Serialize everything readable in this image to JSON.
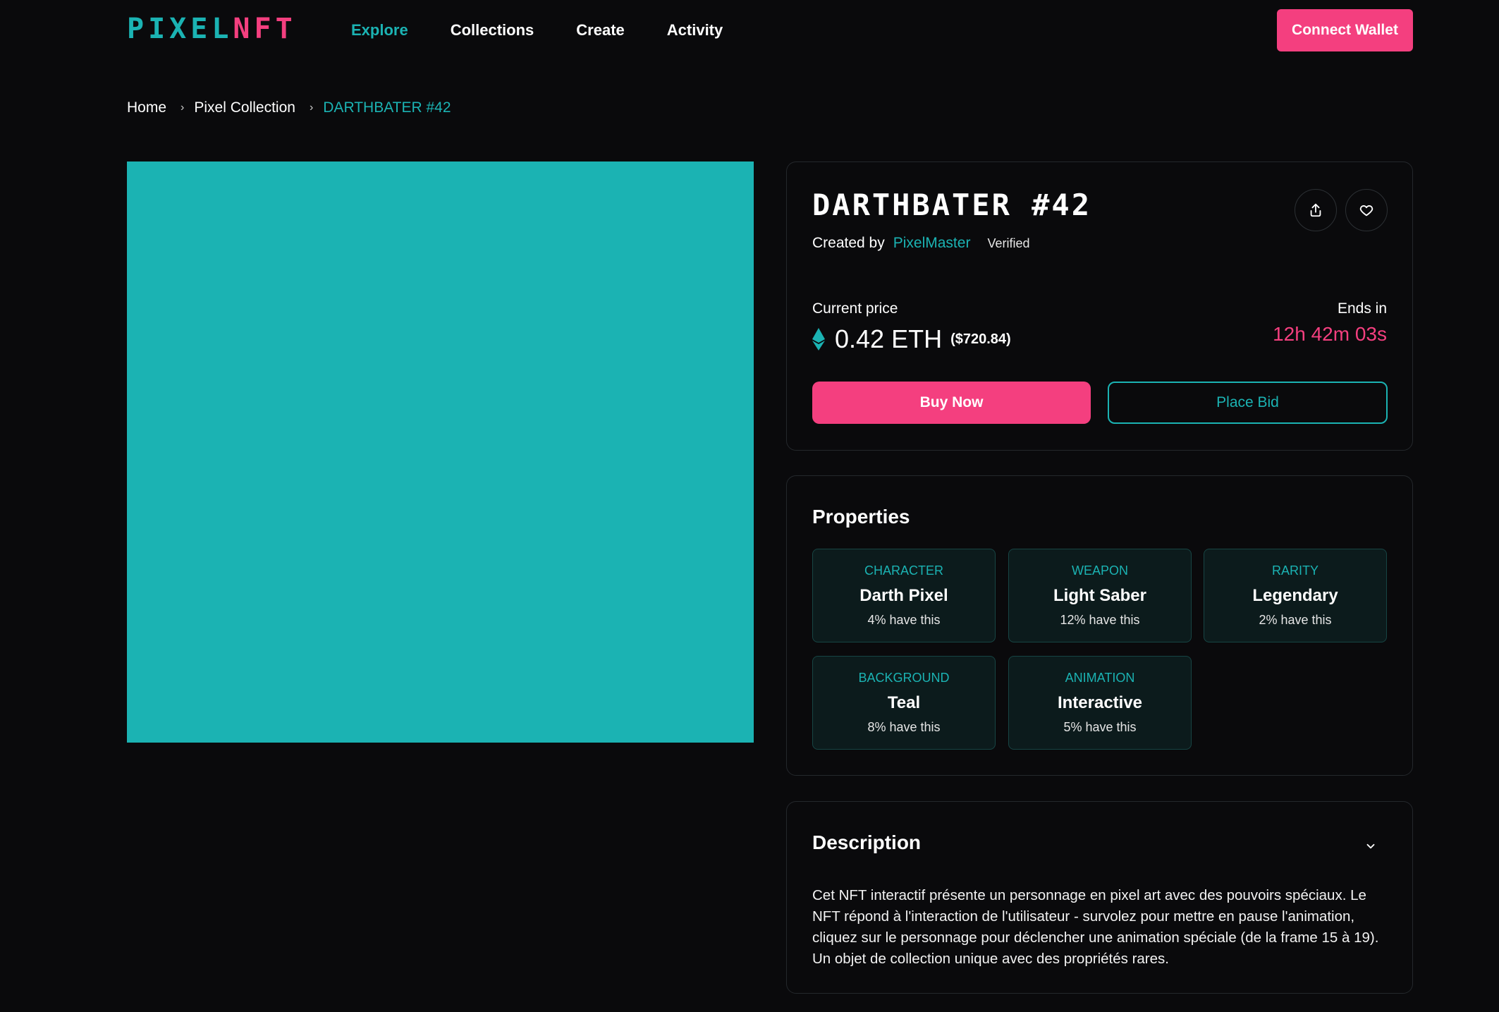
{
  "brand": {
    "part1": "PIXEL",
    "part2": "NFT",
    "accent": "#1bb3b3",
    "pink": "#f43f7f"
  },
  "nav": {
    "items": [
      {
        "label": "Explore",
        "active": true
      },
      {
        "label": "Collections"
      },
      {
        "label": "Create"
      },
      {
        "label": "Activity"
      }
    ],
    "connect_label": "Connect Wallet"
  },
  "breadcrumb": {
    "home": "Home",
    "collection": "Pixel Collection",
    "current": "DARTHBATER #42"
  },
  "nft": {
    "title": "DARTHBATER #42",
    "created_by_label": "Created by",
    "creator": "PixelMaster",
    "verified": "Verified",
    "artwork_color": "#1bb3b3",
    "icons": {
      "share": "share-icon",
      "favorite": "heart-icon",
      "currency": "ethereum-icon"
    }
  },
  "price": {
    "label": "Current price",
    "amount": "0.42 ETH",
    "usd": "($720.84)",
    "ends_label": "Ends in",
    "countdown": "12h 42m 03s"
  },
  "actions": {
    "buy": "Buy Now",
    "bid": "Place Bid"
  },
  "properties": {
    "title": "Properties",
    "items": [
      {
        "type": "CHARACTER",
        "value": "Darth Pixel",
        "freq": "4% have this"
      },
      {
        "type": "WEAPON",
        "value": "Light Saber",
        "freq": "12% have this"
      },
      {
        "type": "RARITY",
        "value": "Legendary",
        "freq": "2% have this"
      },
      {
        "type": "BACKGROUND",
        "value": "Teal",
        "freq": "8% have this"
      },
      {
        "type": "ANIMATION",
        "value": "Interactive",
        "freq": "5% have this"
      }
    ]
  },
  "description": {
    "title": "Description",
    "text": "Cet NFT interactif présente un personnage en pixel art avec des pouvoirs spéciaux. Le NFT répond à l'interaction de l'utilisateur - survolez pour mettre en pause l'animation, cliquez sur le personnage pour déclencher une animation spéciale (de la frame 15 à 19). Un objet de collection unique avec des propriétés rares."
  }
}
